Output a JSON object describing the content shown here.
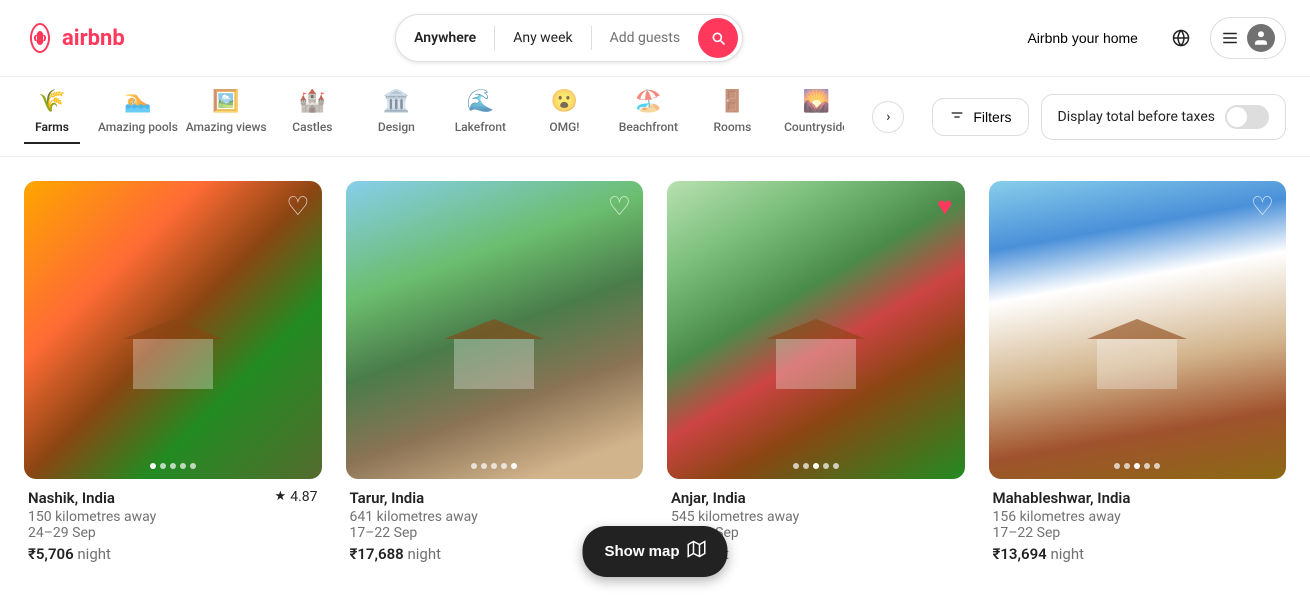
{
  "header": {
    "logo_text": "airbnb",
    "search": {
      "anywhere_label": "Anywhere",
      "any_week_label": "Any week",
      "add_guests_label": "Add guests"
    },
    "airbnb_home_label": "Airbnb your home",
    "menu_icon": "≡"
  },
  "categories": {
    "items": [
      {
        "id": "farms",
        "icon": "🌾",
        "label": "Farms",
        "active": true
      },
      {
        "id": "amazing-pools",
        "icon": "🏊",
        "label": "Amazing pools",
        "active": false
      },
      {
        "id": "amazing-views",
        "icon": "🖼️",
        "label": "Amazing views",
        "active": false
      },
      {
        "id": "castles",
        "icon": "🏰",
        "label": "Castles",
        "active": false
      },
      {
        "id": "design",
        "icon": "🏛️",
        "label": "Design",
        "active": false
      },
      {
        "id": "lakefront",
        "icon": "🌊",
        "label": "Lakefront",
        "active": false
      },
      {
        "id": "omg",
        "icon": "😮",
        "label": "OMG!",
        "active": false
      },
      {
        "id": "beachfront",
        "icon": "🏖️",
        "label": "Beachfront",
        "active": false
      },
      {
        "id": "rooms",
        "icon": "🚪",
        "label": "Rooms",
        "active": false
      },
      {
        "id": "countryside",
        "icon": "🌄",
        "label": "Countryside",
        "active": false
      }
    ],
    "next_arrow": "›",
    "filters_label": "Filters",
    "display_total_label": "Display total before taxes"
  },
  "listings": [
    {
      "id": "nashik",
      "location": "Nashik, India",
      "distance": "150 kilometres away",
      "dates": "24–29 Sep",
      "price": "₹5,706",
      "price_suffix": "night",
      "rating": "4.87",
      "img_class": "img-nashik",
      "dots": [
        true,
        false,
        false,
        false,
        false
      ],
      "wishlist_filled": false
    },
    {
      "id": "tarur",
      "location": "Tarur, India",
      "distance": "641 kilometres away",
      "dates": "17–22 Sep",
      "price": "₹17,688",
      "price_suffix": "night",
      "rating": null,
      "img_class": "img-tarur",
      "dots": [
        false,
        false,
        false,
        false,
        true
      ],
      "wishlist_filled": false
    },
    {
      "id": "anjar",
      "location": "Anjar, India",
      "distance": "545 kilometres away",
      "dates": "17–22 Sep",
      "price": "₹...",
      "price_suffix": "night",
      "rating": null,
      "img_class": "img-anjar",
      "dots": [
        false,
        false,
        true,
        false,
        false
      ],
      "wishlist_filled": true
    },
    {
      "id": "mahableshwar",
      "location": "Mahableshwar, India",
      "distance": "156 kilometres away",
      "dates": "17–22 Sep",
      "price": "₹13,694",
      "price_suffix": "night",
      "rating": null,
      "img_class": "img-mahableshwar",
      "dots": [
        false,
        false,
        true,
        false,
        false
      ],
      "wishlist_filled": false
    }
  ],
  "show_map": {
    "label": "Show map",
    "icon": "⊞"
  }
}
